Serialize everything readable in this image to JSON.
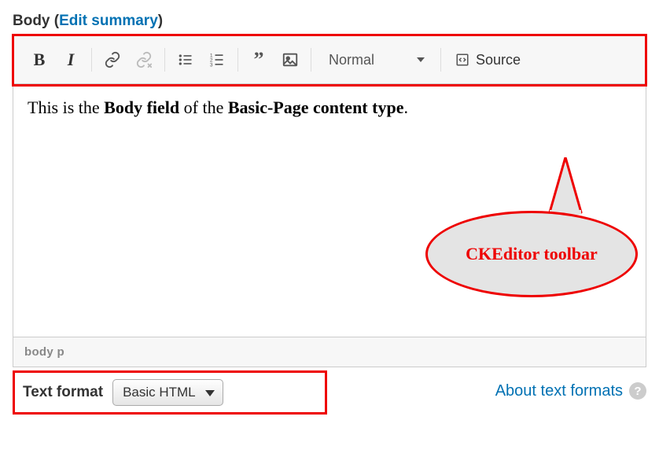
{
  "field": {
    "label": "Body",
    "edit_summary_text": "Edit summary"
  },
  "toolbar": {
    "format_label": "Normal",
    "source_label": "Source"
  },
  "content": {
    "segments": {
      "t1": "This is the ",
      "b1": "Body field",
      "t2": " of the ",
      "b2": "Basic-Page content type",
      "t3": "."
    }
  },
  "path_bar": "body   p",
  "text_format": {
    "label": "Text format",
    "selected": "Basic HTML"
  },
  "about_link": "About text formats",
  "callout_label": "CKEditor toolbar"
}
